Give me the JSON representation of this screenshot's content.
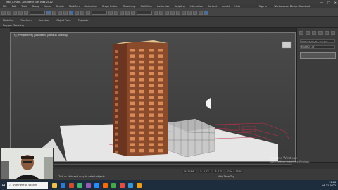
{
  "title_bar": {
    "title": "test_1.max - Autodesk 3ds Max 2022",
    "buttons": [
      "—",
      "□",
      "✕"
    ]
  },
  "menu": {
    "items": [
      "File",
      "Edit",
      "Tools",
      "Group",
      "Views",
      "Create",
      "Modifiers",
      "Animation",
      "Graph Editors",
      "Rendering",
      "Civil View",
      "Customize",
      "Scripting",
      "Interactive",
      "Content",
      "Arnold",
      "Help"
    ],
    "sign_in": "Sign In",
    "workspace": "Workspaces: Design Standard"
  },
  "ribbon": {
    "tabs": [
      "Modeling",
      "Freeform",
      "Selection",
      "Object Paint",
      "Populate"
    ],
    "sub_label": "Polygon Modeling"
  },
  "viewport": {
    "label": "[+] [Perspective] [Standard] [Default Shading]"
  },
  "command_panel": {
    "object_name": "G Sheet_Dir_the ean.png",
    "modifier_list": "Modifier List"
  },
  "status_bar": {
    "message": "Click or click-and-drag to select objects",
    "coords": [
      "X: 114.6'",
      "Y: -6.22'",
      "Z: 0.0'",
      "Grid = 10.0'"
    ],
    "add_time_tag": "Add Time Tag"
  },
  "watermark": {
    "line1": "Activate Windows",
    "line2": "Go to Settings to activate Windows."
  },
  "taskbar": {
    "search_placeholder": "Type here to search",
    "time": "11:06",
    "date": "06-11-2022",
    "icon_colors": [
      "#f0c040",
      "#2a7bd4",
      "#d84b2a",
      "#3dbb6a",
      "#9b59b6",
      "#1e90ff",
      "#ff6a00",
      "#44aa44",
      "#e74c3c",
      "#3498db",
      "#f39c12"
    ]
  },
  "colors": {
    "building_body": "#8a4a2c",
    "building_window": "#d98a55",
    "roof": "#e8c890",
    "ground": "#e6e6e6",
    "site_lines": "#c0304a"
  }
}
